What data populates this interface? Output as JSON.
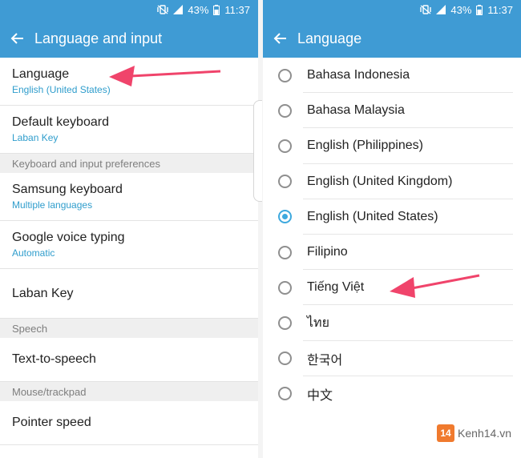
{
  "colors": {
    "header": "#3f9bd4",
    "accent": "#2f9dcc",
    "radio_checked": "#3ea9de",
    "arrow": "#f0446b"
  },
  "status": {
    "battery": "43%",
    "time": "11:37"
  },
  "left": {
    "title": "Language and input",
    "items": [
      {
        "label": "Language",
        "sub": "English (United States)"
      },
      {
        "label": "Default keyboard",
        "sub": "Laban Key"
      }
    ],
    "section_keyboard": "Keyboard and input preferences",
    "keyboard_items": [
      {
        "label": "Samsung keyboard",
        "sub": "Multiple languages"
      },
      {
        "label": "Google voice typing",
        "sub": "Automatic"
      },
      {
        "label": "Laban Key"
      }
    ],
    "section_speech": "Speech",
    "speech_item": "Text-to-speech",
    "section_mouse": "Mouse/trackpad",
    "mouse_item": "Pointer speed"
  },
  "right": {
    "title": "Language",
    "options": [
      {
        "label": "Bahasa Indonesia",
        "selected": false
      },
      {
        "label": "Bahasa Malaysia",
        "selected": false
      },
      {
        "label": "English (Philippines)",
        "selected": false
      },
      {
        "label": "English (United Kingdom)",
        "selected": false
      },
      {
        "label": "English (United States)",
        "selected": true
      },
      {
        "label": "Filipino",
        "selected": false
      },
      {
        "label": "Tiếng Việt",
        "selected": false
      },
      {
        "label": "ไทย",
        "selected": false
      },
      {
        "label": "한국어",
        "selected": false
      },
      {
        "label": "中文",
        "selected": false
      }
    ]
  },
  "watermark": {
    "logo": "14",
    "text": "Kenh14.vn"
  },
  "icons": [
    "back-arrow-icon",
    "signal-icon",
    "battery-icon",
    "vibrate-icon",
    "radio-button-icon"
  ]
}
